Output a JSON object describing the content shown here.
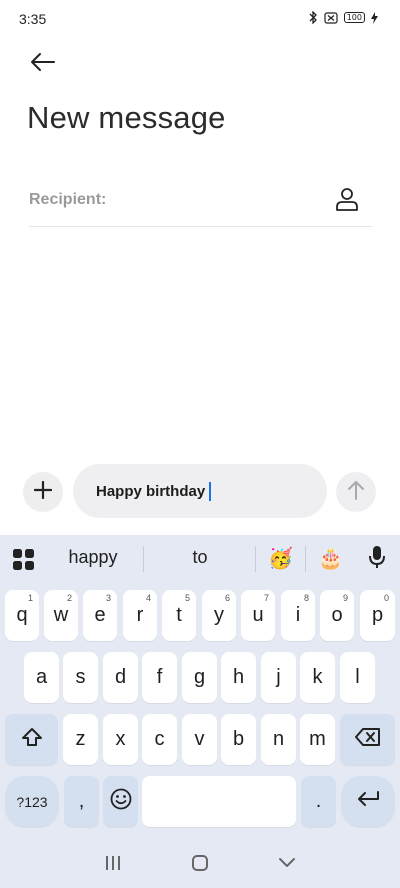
{
  "status_bar": {
    "time": "3:35",
    "battery": "100"
  },
  "header": {
    "title": "New message"
  },
  "recipient": {
    "label": "Recipient:"
  },
  "compose": {
    "text": "Happy birthday"
  },
  "keyboard": {
    "suggestions": [
      "happy",
      "to"
    ],
    "emoji_suggestions": [
      "🥳",
      "🎂"
    ],
    "row1": [
      {
        "key": "q",
        "hint": "1"
      },
      {
        "key": "w",
        "hint": "2"
      },
      {
        "key": "e",
        "hint": "3"
      },
      {
        "key": "r",
        "hint": "4"
      },
      {
        "key": "t",
        "hint": "5"
      },
      {
        "key": "y",
        "hint": "6"
      },
      {
        "key": "u",
        "hint": "7"
      },
      {
        "key": "i",
        "hint": "8"
      },
      {
        "key": "o",
        "hint": "9"
      },
      {
        "key": "p",
        "hint": "0"
      }
    ],
    "row2": [
      "a",
      "s",
      "d",
      "f",
      "g",
      "h",
      "j",
      "k",
      "l"
    ],
    "row3": [
      "z",
      "x",
      "c",
      "v",
      "b",
      "n",
      "m"
    ],
    "symbols_label": "?123",
    "comma": ",",
    "period": "."
  },
  "icons": {
    "back": "arrow-left-icon",
    "contact": "person-icon",
    "add": "plus-icon",
    "send": "arrow-up-icon",
    "keyboard_menu": "grid-icon",
    "mic": "mic-icon",
    "shift": "shift-icon",
    "backspace": "backspace-icon",
    "emoji": "smiley-icon",
    "enter": "enter-icon",
    "nav_recents": "recents-icon",
    "nav_home": "home-icon",
    "nav_back": "chevron-down-icon"
  },
  "colors": {
    "accent": "#1a73e8",
    "keyboard_bg": "#e4e9f3",
    "function_key": "#d4e0ef"
  }
}
